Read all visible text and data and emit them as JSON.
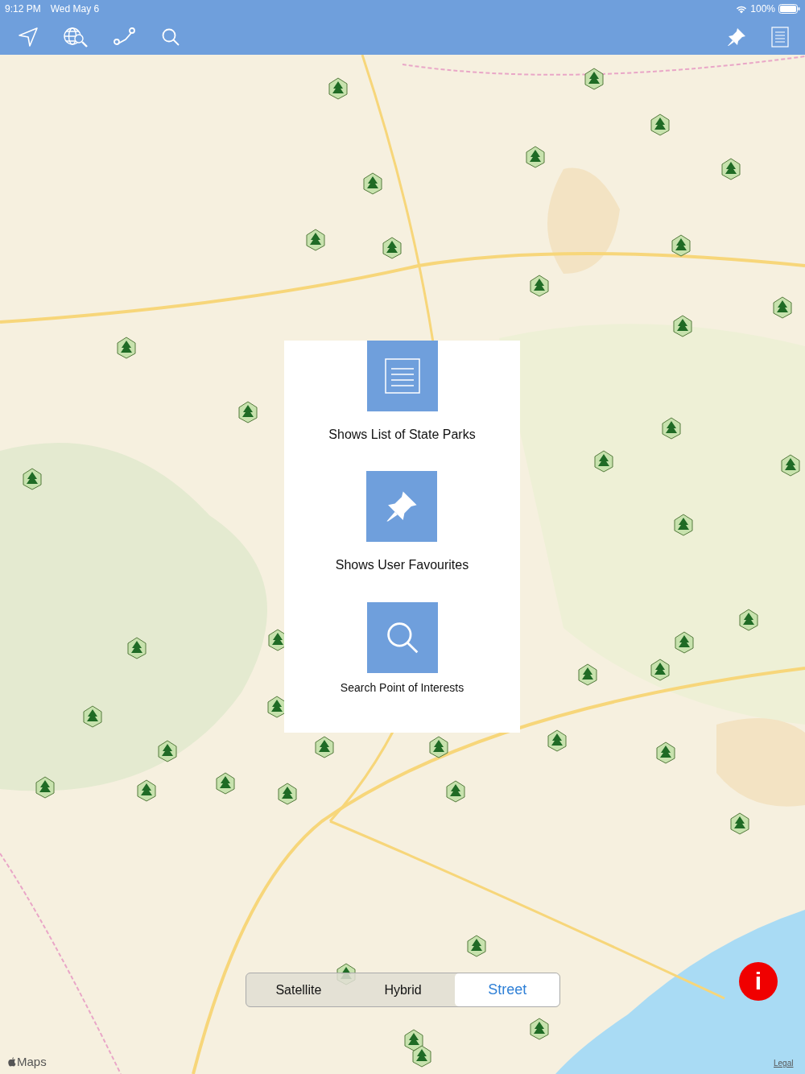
{
  "status_bar": {
    "time": "9:12 PM",
    "date": "Wed May 6",
    "battery": "100%"
  },
  "popup": {
    "items": [
      {
        "kind": "list",
        "label": "Shows List of State Parks"
      },
      {
        "kind": "pin",
        "label": "Shows User Favourites"
      },
      {
        "kind": "search",
        "label": "Search Point of Interests"
      }
    ]
  },
  "map_type": {
    "segments": [
      {
        "label": "Satellite",
        "selected": false
      },
      {
        "label": "Hybrid",
        "selected": false
      },
      {
        "label": "Street",
        "selected": true
      }
    ]
  },
  "info_button": {
    "label": "i"
  },
  "attribution": {
    "logo": "Maps",
    "legal": "Legal"
  }
}
